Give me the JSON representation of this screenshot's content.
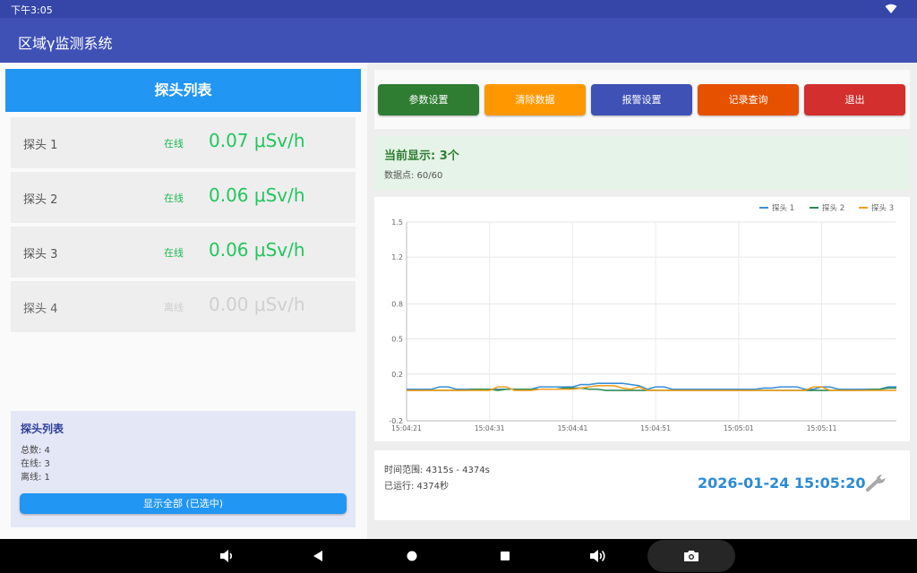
{
  "status_bar": {
    "time": "下午3:05"
  },
  "app_bar": {
    "title": "区域γ监测系统"
  },
  "probe_panel": {
    "header": "探头列表",
    "probes": [
      {
        "name": "探头 1",
        "status": "在线",
        "value": "0.07 μSv/h",
        "online": true
      },
      {
        "name": "探头 2",
        "status": "在线",
        "value": "0.06 μSv/h",
        "online": true
      },
      {
        "name": "探头 3",
        "status": "在线",
        "value": "0.06 μSv/h",
        "online": true
      },
      {
        "name": "探头 4",
        "status": "离线",
        "value": "0.00 μSv/h",
        "online": false
      }
    ],
    "summary": {
      "title": "探头列表",
      "total": "总数: 4",
      "online": "在线: 3",
      "offline": "离线: 1",
      "show_all_button": "显示全部 (已选中)"
    }
  },
  "toolbar": {
    "buttons": [
      {
        "label": "参数设置",
        "color": "#2e7d32"
      },
      {
        "label": "清除数据",
        "color": "#ff9800"
      },
      {
        "label": "报警设置",
        "color": "#3f51b5"
      },
      {
        "label": "记录查询",
        "color": "#e65100"
      },
      {
        "label": "退出",
        "color": "#d32f2f"
      }
    ]
  },
  "display_info": {
    "title": "当前显示: 3个",
    "points": "数据点: 60/60"
  },
  "chart_data": {
    "type": "line",
    "title": "",
    "xlabel": "",
    "ylabel": "",
    "ylim": [
      -0.2,
      1.5
    ],
    "y_ticks": [
      "1.5",
      "1.2",
      "0.8",
      "0.5",
      "0.2",
      "-0.2"
    ],
    "y_tick_values": [
      1.5,
      1.2,
      0.8,
      0.5,
      0.2,
      -0.2
    ],
    "x_ticks": [
      "15:04:21",
      "15:04:31",
      "15:04:41",
      "15:04:51",
      "15:05:01",
      "15:05:11"
    ],
    "x_tick_values": [
      0,
      10,
      20,
      30,
      40,
      50
    ],
    "x_range": [
      0,
      59
    ],
    "grid": true,
    "legend_position": "top-right",
    "series": [
      {
        "name": "探头 1",
        "color": "#3a8fd9",
        "values": [
          0.07,
          0.07,
          0.07,
          0.07,
          0.09,
          0.09,
          0.07,
          0.07,
          0.07,
          0.07,
          0.07,
          0.07,
          0.07,
          0.07,
          0.07,
          0.07,
          0.09,
          0.09,
          0.09,
          0.09,
          0.09,
          0.11,
          0.11,
          0.12,
          0.12,
          0.12,
          0.12,
          0.11,
          0.1,
          0.07,
          0.09,
          0.09,
          0.07,
          0.07,
          0.07,
          0.07,
          0.07,
          0.07,
          0.07,
          0.07,
          0.07,
          0.07,
          0.07,
          0.08,
          0.08,
          0.09,
          0.09,
          0.09,
          0.07,
          0.07,
          0.09,
          0.09,
          0.07,
          0.07,
          0.07,
          0.07,
          0.07,
          0.07,
          0.09,
          0.09
        ]
      },
      {
        "name": "探头 2",
        "color": "#2e8b57",
        "values": [
          0.06,
          0.06,
          0.06,
          0.06,
          0.06,
          0.06,
          0.06,
          0.06,
          0.07,
          0.07,
          0.07,
          0.06,
          0.07,
          0.07,
          0.07,
          0.07,
          0.07,
          0.07,
          0.07,
          0.08,
          0.08,
          0.08,
          0.07,
          0.07,
          0.06,
          0.06,
          0.06,
          0.06,
          0.06,
          0.06,
          0.06,
          0.06,
          0.06,
          0.06,
          0.06,
          0.06,
          0.06,
          0.06,
          0.06,
          0.06,
          0.06,
          0.06,
          0.06,
          0.06,
          0.06,
          0.06,
          0.06,
          0.06,
          0.06,
          0.06,
          0.06,
          0.06,
          0.06,
          0.06,
          0.06,
          0.06,
          0.07,
          0.07,
          0.08,
          0.08
        ]
      },
      {
        "name": "探头 3",
        "color": "#f0a020",
        "values": [
          0.06,
          0.06,
          0.06,
          0.06,
          0.06,
          0.06,
          0.06,
          0.06,
          0.06,
          0.06,
          0.06,
          0.09,
          0.09,
          0.06,
          0.06,
          0.06,
          0.07,
          0.07,
          0.07,
          0.07,
          0.07,
          0.08,
          0.09,
          0.1,
          0.1,
          0.1,
          0.08,
          0.07,
          0.09,
          0.06,
          0.06,
          0.06,
          0.06,
          0.06,
          0.06,
          0.06,
          0.06,
          0.06,
          0.06,
          0.06,
          0.06,
          0.06,
          0.06,
          0.06,
          0.06,
          0.06,
          0.06,
          0.06,
          0.06,
          0.09,
          0.09,
          0.06,
          0.06,
          0.06,
          0.06,
          0.06,
          0.06,
          0.06,
          0.06,
          0.06
        ]
      }
    ]
  },
  "footer": {
    "time_range": "时间范围: 4315s - 4374s",
    "uptime": "已运行: 4374秒",
    "datetime": "2026-01-24  15:05:20"
  }
}
